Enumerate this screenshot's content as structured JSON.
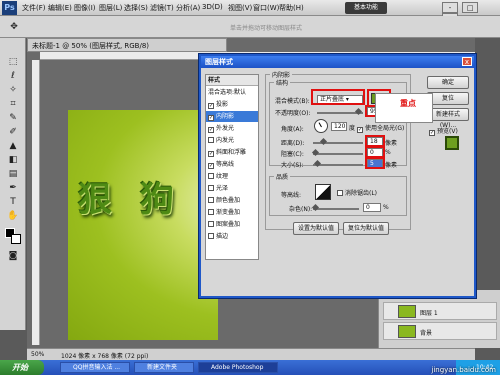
{
  "app": {
    "logo": "Ps",
    "workspace": "基本功能",
    "window_controls": [
      "-",
      "□",
      "x"
    ]
  },
  "menubar": [
    "文件(F)",
    "编辑(E)",
    "图像(I)",
    "图层(L)",
    "选择(S)",
    "滤镜(T)",
    "分析(A)",
    "3D(D)",
    "视图(V)",
    "窗口(W)",
    "帮助(H)"
  ],
  "optbar": {
    "hint": "单击并拖动可移动图层样式"
  },
  "document": {
    "tab": "未标题-1 @ 50% (图层样式, RGB/8)",
    "title_chars": [
      "狠",
      "狗"
    ]
  },
  "status": {
    "zoom": "50%",
    "size": "1024 像素 x 768 像素 (72 ppi)"
  },
  "dialog": {
    "title": "图层样式",
    "close": "x",
    "styles_header": "样式",
    "blend_options": "混合选项:默认",
    "styles": [
      {
        "label": "投影",
        "checked": true
      },
      {
        "label": "内阴影",
        "checked": true,
        "selected": true
      },
      {
        "label": "外发光",
        "checked": true
      },
      {
        "label": "内发光",
        "checked": false
      },
      {
        "label": "斜面和浮雕",
        "checked": true
      },
      {
        "label": "等高线",
        "checked": true
      },
      {
        "label": "纹理",
        "checked": false
      },
      {
        "label": "光泽",
        "checked": false
      },
      {
        "label": "颜色叠加",
        "checked": false
      },
      {
        "label": "渐变叠加",
        "checked": false
      },
      {
        "label": "图案叠加",
        "checked": false
      },
      {
        "label": "描边",
        "checked": false
      }
    ],
    "section_title": "内阴影",
    "structure_title": "结构",
    "blend_mode_label": "混合模式(B):",
    "blend_mode": "正片叠底",
    "shadow_color": "#6a9a20",
    "opacity_label": "不透明度(O):",
    "opacity": "95",
    "opacity_fraction": 0.95,
    "angle_label": "角度(A):",
    "angle": "120",
    "degree_unit": "度",
    "global_light": "使用全局光(G)",
    "distance_label": "距离(D):",
    "distance": "18",
    "distance_fraction": 0.18,
    "choke_label": "阻塞(C):",
    "choke": "0",
    "choke_fraction": 0,
    "size_label": "大小(S):",
    "size": "5",
    "size_fraction": 0.05,
    "px": "像素",
    "percent": "%",
    "quality_title": "品质",
    "contour_label": "等高线:",
    "antialias": "消除锯齿(L)",
    "noise_label": "杂色(N):",
    "noise": "0",
    "noise_fraction": 0,
    "make_default": "设置为默认值",
    "reset_default": "复位为默认值",
    "ok": "确定",
    "reset": "复位",
    "new_style": "新建样式(W)...",
    "preview": "预览(V)"
  },
  "annotation": "重点",
  "layers": [
    {
      "name": "图层 1"
    },
    {
      "name": "背景"
    }
  ],
  "taskbar": {
    "start": "开始",
    "tasks": [
      "QQ拼音输入法 ...",
      "新建文件夹",
      "Adobe Photoshop"
    ],
    "clock": "10:42"
  },
  "watermark": "jingyan.baidu.com"
}
